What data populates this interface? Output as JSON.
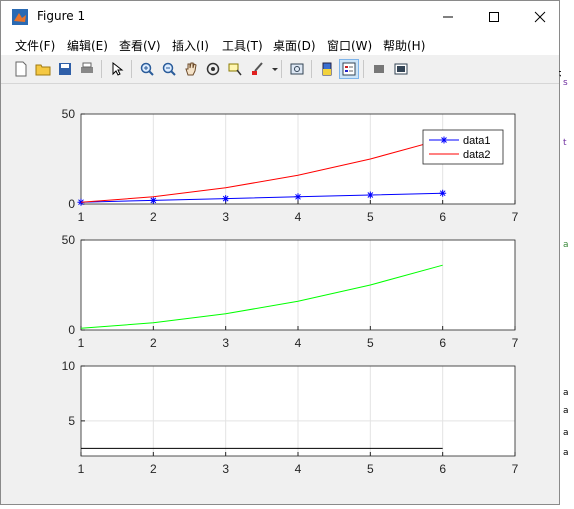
{
  "window": {
    "title": "Figure 1"
  },
  "menu": [
    "文件(F)",
    "编辑(E)",
    "查看(V)",
    "插入(I)",
    "工具(T)",
    "桌面(D)",
    "窗口(W)",
    "帮助(H)"
  ],
  "toolbar": [
    "new-figure-icon",
    "open-file-icon",
    "save-icon",
    "print-icon",
    "pointer-icon",
    "zoom-in-icon",
    "zoom-out-icon",
    "pan-icon",
    "rotate-3d-icon",
    "data-cursor-icon",
    "brush-icon",
    "link-plot-icon",
    "colorbar-icon",
    "legend-icon",
    "hide-plot-tools-icon",
    "show-plot-tools-icon"
  ],
  "side_marks": [
    "s",
    "t",
    "a",
    "a",
    "a",
    "a",
    "a"
  ],
  "chart_data": [
    {
      "type": "line",
      "x": [
        1,
        2,
        3,
        4,
        5,
        6
      ],
      "series": [
        {
          "name": "data1",
          "values": [
            1,
            2,
            3,
            4,
            5,
            6
          ],
          "color": "#0000ff",
          "marker": "asterisk"
        },
        {
          "name": "data2",
          "values": [
            1,
            4,
            9,
            16,
            25,
            36
          ],
          "color": "#ff0000"
        }
      ],
      "xlim": [
        1,
        7
      ],
      "ylim": [
        0,
        50
      ],
      "xticks": [
        1,
        2,
        3,
        4,
        5,
        6,
        7
      ],
      "yticks": [
        0,
        50
      ],
      "grid": true,
      "legend": "top-right"
    },
    {
      "type": "line",
      "x": [
        1,
        2,
        3,
        4,
        5,
        6
      ],
      "series": [
        {
          "values": [
            1,
            4,
            9,
            16,
            25,
            36
          ],
          "color": "#00ff00"
        }
      ],
      "xlim": [
        1,
        7
      ],
      "ylim": [
        0,
        50
      ],
      "xticks": [
        1,
        2,
        3,
        4,
        5,
        6,
        7
      ],
      "yticks": [
        0,
        50
      ],
      "grid": true
    },
    {
      "type": "line",
      "x": [
        1,
        2,
        3,
        4,
        5,
        6
      ],
      "series": [
        {
          "values": [
            2.5,
            2.5,
            2.5,
            2.5,
            2.5,
            2.5
          ],
          "color": "#000000"
        }
      ],
      "xlim": [
        1,
        7
      ],
      "ylim": [
        1.8,
        10
      ],
      "xticks": [
        1,
        2,
        3,
        4,
        5,
        6,
        7
      ],
      "yticks": [
        5,
        10
      ],
      "grid": true
    }
  ]
}
